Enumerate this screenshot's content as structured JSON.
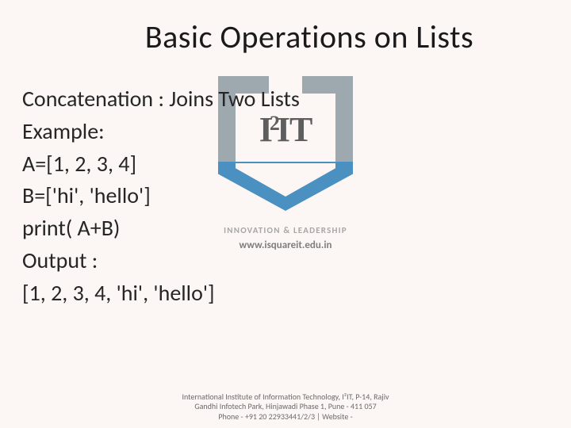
{
  "title": "Basic Operations on Lists",
  "content": {
    "line1": "Concatenation : Joins Two Lists",
    "line2": "Example:",
    "line3": "A=[1, 2, 3, 4]",
    "line4": "B=['hi', 'hello']",
    "line5": "print( A+B)",
    "line6": "Output :",
    "line7": "[1, 2, 3, 4, 'hi', 'hello']"
  },
  "watermark": {
    "logo_i": "I",
    "logo_sup": "2",
    "logo_it": "IT",
    "tagline": "INNOVATION & LEADERSHIP",
    "url": "www.isquareit.edu.in"
  },
  "footer": {
    "line1": "International Institute of Information Technology, I²IT, P-14, Rajiv Gandhi Infotech Park, Hinjawadi Phase 1, Pune - 411 057",
    "line2": "Phone - +91 20 22933441/2/3 | Website -"
  }
}
